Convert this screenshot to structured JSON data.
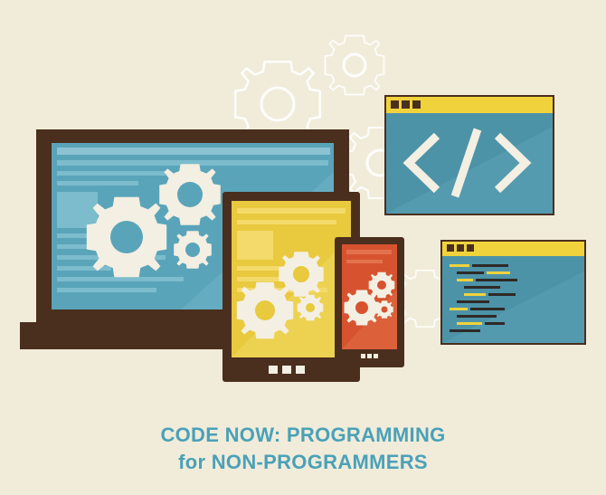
{
  "caption": {
    "line1": "CODE NOW: PROGRAMMING",
    "line2": "for NON-PROGRAMMERS"
  },
  "colors": {
    "background": "#f1ecd9",
    "frame_dark": "#4a2e1e",
    "screen_blue": "#5aa4b9",
    "tablet_yellow": "#e9c93d",
    "phone_red": "#d7532f",
    "window_yellow": "#f0d23c",
    "window_blue": "#4d93a8",
    "caption_blue": "#4aa1b9",
    "gear_light": "#f3efe2"
  },
  "icons": [
    "laptop-icon",
    "tablet-icon",
    "phone-icon",
    "code-window-icon",
    "code-list-window-icon",
    "gear-icon"
  ]
}
